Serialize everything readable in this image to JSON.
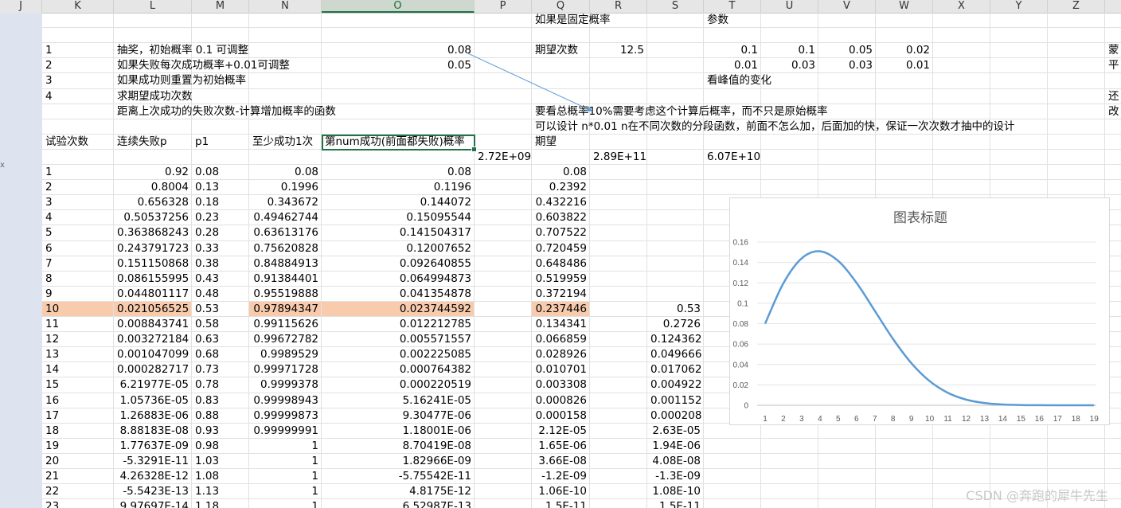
{
  "column_headers": [
    {
      "label": "J"
    },
    {
      "label": "K"
    },
    {
      "label": "L"
    },
    {
      "label": "M"
    },
    {
      "label": "N"
    },
    {
      "label": "O",
      "selected": true
    },
    {
      "label": "P"
    },
    {
      "label": "Q"
    },
    {
      "label": "R"
    },
    {
      "label": "S"
    },
    {
      "label": "T"
    },
    {
      "label": "U"
    },
    {
      "label": "V"
    },
    {
      "label": "W"
    },
    {
      "label": "X"
    },
    {
      "label": "Y"
    },
    {
      "label": "Z"
    },
    {
      "label": ""
    }
  ],
  "left_stub": "x",
  "cells": [
    {
      "c": "Q",
      "r": 1,
      "v": "如果是固定概率"
    },
    {
      "c": "T",
      "r": 1,
      "v": "参数"
    },
    {
      "c": "K",
      "r": 3,
      "v": "1"
    },
    {
      "c": "L",
      "r": 3,
      "v": "抽奖，初始概率 0.1 可调整"
    },
    {
      "c": "O",
      "r": 3,
      "v": "0.08",
      "n": 1
    },
    {
      "c": "Q",
      "r": 3,
      "v": "期望次数"
    },
    {
      "c": "R",
      "r": 3,
      "v": "12.5",
      "n": 1
    },
    {
      "c": "T",
      "r": 3,
      "v": "0.1",
      "n": 1
    },
    {
      "c": "U",
      "r": 3,
      "v": "0.1",
      "n": 1
    },
    {
      "c": "V",
      "r": 3,
      "v": "0.05",
      "n": 1
    },
    {
      "c": "W",
      "r": 3,
      "v": "0.02",
      "n": 1
    },
    {
      "c": "AA",
      "r": 3,
      "v": "蒙"
    },
    {
      "c": "K",
      "r": 4,
      "v": "2"
    },
    {
      "c": "L",
      "r": 4,
      "v": "如果失败每次成功概率+0.01可调整"
    },
    {
      "c": "O",
      "r": 4,
      "v": "0.05",
      "n": 1
    },
    {
      "c": "T",
      "r": 4,
      "v": "0.01",
      "n": 1
    },
    {
      "c": "U",
      "r": 4,
      "v": "0.03",
      "n": 1
    },
    {
      "c": "V",
      "r": 4,
      "v": "0.03",
      "n": 1
    },
    {
      "c": "W",
      "r": 4,
      "v": "0.01",
      "n": 1
    },
    {
      "c": "AA",
      "r": 4,
      "v": "平"
    },
    {
      "c": "K",
      "r": 5,
      "v": "3"
    },
    {
      "c": "L",
      "r": 5,
      "v": "如果成功则重置为初始概率"
    },
    {
      "c": "T",
      "r": 5,
      "v": "看峰值的变化"
    },
    {
      "c": "K",
      "r": 6,
      "v": "4"
    },
    {
      "c": "L",
      "r": 6,
      "v": "求期望成功次数"
    },
    {
      "c": "AA",
      "r": 6,
      "v": "还"
    },
    {
      "c": "L",
      "r": 7,
      "v": "距离上次成功的失败次数-计算增加概率的函数"
    },
    {
      "c": "Q",
      "r": 7,
      "v": "要看总概率10%需要考虑这个计算后概率，而不只是原始概率"
    },
    {
      "c": "AA",
      "r": 7,
      "v": "改"
    },
    {
      "c": "Q",
      "r": 8,
      "v": "可以设计  n*0.01 n在不同次数的分段函数，前面不怎么加，后面加的快，保证一次次数才抽中的设计"
    },
    {
      "c": "K",
      "r": 9,
      "v": "试验次数"
    },
    {
      "c": "L",
      "r": 9,
      "v": "连续失败p"
    },
    {
      "c": "M",
      "r": 9,
      "v": "p1"
    },
    {
      "c": "N",
      "r": 9,
      "v": "至少成功1次"
    },
    {
      "c": "O",
      "r": 9,
      "v": "第num成功(前面都失败)概率"
    },
    {
      "c": "Q",
      "r": 9,
      "v": "期望"
    },
    {
      "c": "P",
      "r": 10,
      "v": "2.72E+09",
      "n": 1
    },
    {
      "c": "R",
      "r": 10,
      "v": "2.89E+11",
      "n": 1
    },
    {
      "c": "T",
      "r": 10,
      "v": "6.07E+10",
      "n": 1
    }
  ],
  "table_rows": [
    {
      "k": "1",
      "l": "0.92",
      "m": "0.08",
      "n": "0.08",
      "o": "0.08",
      "q": "0.08",
      "s": ""
    },
    {
      "k": "2",
      "l": "0.8004",
      "m": "0.13",
      "n": "0.1996",
      "o": "0.1196",
      "q": "0.2392",
      "s": ""
    },
    {
      "k": "3",
      "l": "0.656328",
      "m": "0.18",
      "n": "0.343672",
      "o": "0.144072",
      "q": "0.432216",
      "s": ""
    },
    {
      "k": "4",
      "l": "0.50537256",
      "m": "0.23",
      "n": "0.49462744",
      "o": "0.15095544",
      "q": "0.603822",
      "s": ""
    },
    {
      "k": "5",
      "l": "0.363868243",
      "m": "0.28",
      "n": "0.63613176",
      "o": "0.141504317",
      "q": "0.707522",
      "s": ""
    },
    {
      "k": "6",
      "l": "0.243791723",
      "m": "0.33",
      "n": "0.75620828",
      "o": "0.12007652",
      "q": "0.720459",
      "s": ""
    },
    {
      "k": "7",
      "l": "0.151150868",
      "m": "0.38",
      "n": "0.84884913",
      "o": "0.092640855",
      "q": "0.648486",
      "s": ""
    },
    {
      "k": "8",
      "l": "0.086155995",
      "m": "0.43",
      "n": "0.91384401",
      "o": "0.064994873",
      "q": "0.519959",
      "s": ""
    },
    {
      "k": "9",
      "l": "0.044801117",
      "m": "0.48",
      "n": "0.95519888",
      "o": "0.041354878",
      "q": "0.372194",
      "s": ""
    },
    {
      "k": "10",
      "l": "0.021056525",
      "m": "0.53",
      "n": "0.97894347",
      "o": "0.023744592",
      "q": "0.237446",
      "s": "0.53",
      "highlight": true
    },
    {
      "k": "11",
      "l": "0.008843741",
      "m": "0.58",
      "n": "0.99115626",
      "o": "0.012212785",
      "q": "0.134341",
      "s": "0.2726"
    },
    {
      "k": "12",
      "l": "0.003272184",
      "m": "0.63",
      "n": "0.99672782",
      "o": "0.005571557",
      "q": "0.066859",
      "s": "0.124362"
    },
    {
      "k": "13",
      "l": "0.001047099",
      "m": "0.68",
      "n": "0.9989529",
      "o": "0.002225085",
      "q": "0.028926",
      "s": "0.049666"
    },
    {
      "k": "14",
      "l": "0.000282717",
      "m": "0.73",
      "n": "0.99971728",
      "o": "0.000764382",
      "q": "0.010701",
      "s": "0.017062"
    },
    {
      "k": "15",
      "l": "6.21977E-05",
      "m": "0.78",
      "n": "0.9999378",
      "o": "0.000220519",
      "q": "0.003308",
      "s": "0.004922"
    },
    {
      "k": "16",
      "l": "1.05736E-05",
      "m": "0.83",
      "n": "0.99998943",
      "o": "5.16241E-05",
      "q": "0.000826",
      "s": "0.001152"
    },
    {
      "k": "17",
      "l": "1.26883E-06",
      "m": "0.88",
      "n": "0.99999873",
      "o": "9.30477E-06",
      "q": "0.000158",
      "s": "0.000208"
    },
    {
      "k": "18",
      "l": "8.88183E-08",
      "m": "0.93",
      "n": "0.99999991",
      "o": "1.18001E-06",
      "q": "2.12E-05",
      "s": "2.63E-05"
    },
    {
      "k": "19",
      "l": "1.77637E-09",
      "m": "0.98",
      "n": "1",
      "o": "8.70419E-08",
      "q": "1.65E-06",
      "s": "1.94E-06"
    },
    {
      "k": "20",
      "l": "-5.3291E-11",
      "m": "1.03",
      "n": "1",
      "o": "1.82966E-09",
      "q": "3.66E-08",
      "s": "4.08E-08"
    },
    {
      "k": "21",
      "l": "4.26328E-12",
      "m": "1.08",
      "n": "1",
      "o": "-5.75542E-11",
      "q": "-1.2E-09",
      "s": "-1.3E-09"
    },
    {
      "k": "22",
      "l": "-5.5423E-13",
      "m": "1.13",
      "n": "1",
      "o": "4.8175E-12",
      "q": "1.06E-10",
      "s": "1.08E-10"
    },
    {
      "k": "23",
      "l": "9.97697E-14",
      "m": "1.18",
      "n": "1",
      "o": "6.52987E-13",
      "q": "1.5E-11",
      "s": "1.5E-11"
    }
  ],
  "chart_data": {
    "type": "line",
    "title": "图表标题",
    "categories": [
      "1",
      "2",
      "3",
      "4",
      "5",
      "6",
      "7",
      "8",
      "9",
      "10",
      "11",
      "12",
      "13",
      "14",
      "15",
      "16",
      "17",
      "18",
      "19"
    ],
    "y_ticks": [
      "0",
      "0.02",
      "0.04",
      "0.06",
      "0.08",
      "0.1",
      "0.12",
      "0.14",
      "0.16"
    ],
    "ylim": [
      0,
      0.16
    ],
    "grid": true,
    "series": [
      {
        "values": [
          0.08,
          0.1196,
          0.144072,
          0.15095544,
          0.141504317,
          0.12007652,
          0.092640855,
          0.064994873,
          0.041354878,
          0.023744592,
          0.012212785,
          0.005571557,
          0.002225085,
          0.000764382,
          0.000220519,
          5.16241e-05,
          9.30477e-06,
          1.18001e-06,
          8.70419e-08
        ],
        "color": "#5b9bd5"
      }
    ]
  },
  "watermark": "CSDN @奔跑的犀牛先生",
  "colors": {
    "highlight": "#f8cbad",
    "selection": "#217346",
    "line": "#5b9bd5"
  }
}
